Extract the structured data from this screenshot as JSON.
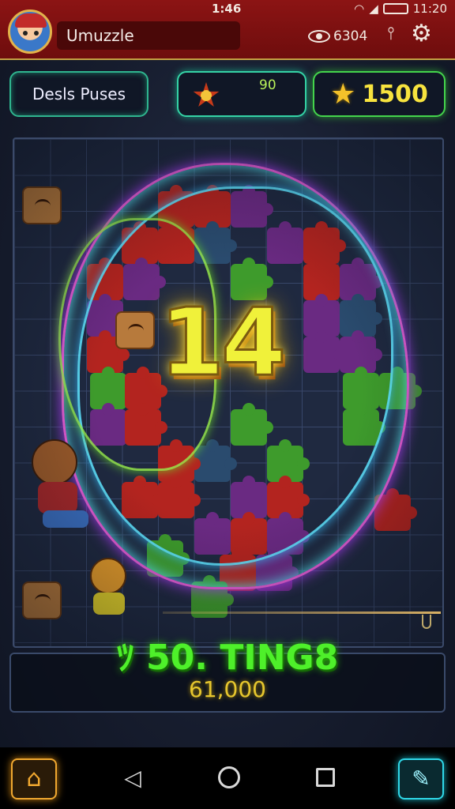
{
  "status_bar": {
    "time": "1:46",
    "clock": "11:20"
  },
  "header": {
    "title": "Umuzzle",
    "coins": "6304",
    "avatar_icon": "boy-avatar",
    "settings_icon": "gear-icon",
    "accent_color": "#8c1414"
  },
  "stats": {
    "pill_label": "Desls Puses",
    "badge_value": "90",
    "star_value": "1500"
  },
  "board": {
    "level": "14",
    "accent_colors": [
      "#b3241f",
      "#3e9b2c",
      "#6a2a82",
      "#f0f13a"
    ]
  },
  "score": {
    "title": "ﾂ 50. TING8",
    "value": "61,000"
  },
  "navbar": {
    "home_icon": "house-icon",
    "back_icon": "back-triangle-icon",
    "circle_icon": "home-circle-icon",
    "recent_icon": "recent-square-icon",
    "edit_icon": "pencil-icon"
  }
}
